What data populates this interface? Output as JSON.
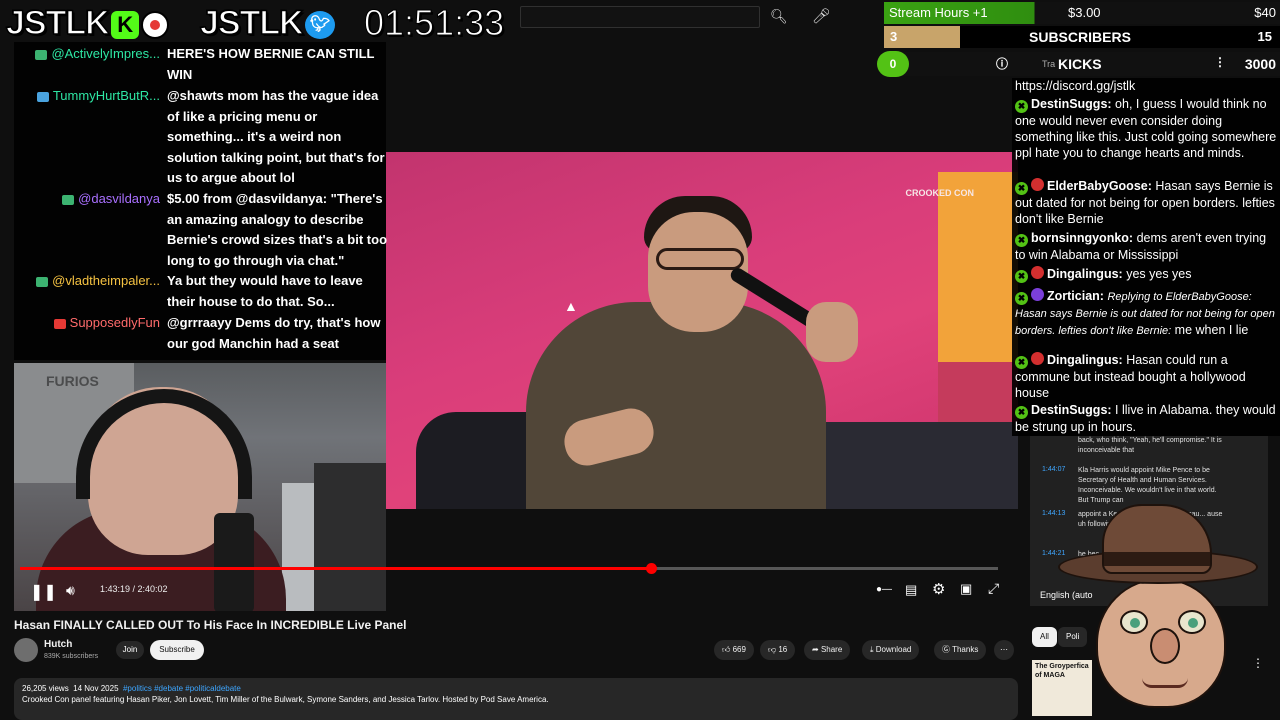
{
  "overlay": {
    "logo_kick": "JSTLK",
    "logo_kick_badge": "K",
    "logo_twitter": "JSTLK",
    "clock": "01:51:33"
  },
  "goals": {
    "stream_hours": {
      "label": "Stream Hours +1",
      "current": "$3.00",
      "target": "$40"
    },
    "subscribers": {
      "label": "SUBSCRIBERS",
      "current": "3",
      "target": "15"
    },
    "kicks": {
      "label": "KICKS",
      "current": "0",
      "target": "3000",
      "prefix": "Tra"
    }
  },
  "left_chat": [
    {
      "name": "@ActivelyImpres...",
      "message": "HERE'S HOW BERNIE CAN STILL WIN",
      "name_color": "#2ee6a4",
      "icon_color": "#3cb371"
    },
    {
      "name": "TummyHurtButR...",
      "message": "@shawts mom has the vague idea of like a pricing menu or something... it's a weird non solution talking point, but that's for us to argue about lol",
      "name_color": "#2ee6a4",
      "icon_color": "#4aa3df"
    },
    {
      "name": "@dasvildanya",
      "message": "$5.00 from @dasvildanya: \"There's an amazing analogy to describe Bernie's crowd sizes that's a bit too long to go through via chat.\"",
      "name_color": "#a970ff",
      "icon_color": "#3cb371"
    },
    {
      "name": "@vladtheimpaler...",
      "message": "Ya but they would have to leave their house to do that. So...",
      "name_color": "#f5c242",
      "icon_color": "#3cb371"
    },
    {
      "name": "SupposedlyFun",
      "message": "@grrraayy Dems do try, that's how our god Manchin had a seat",
      "name_color": "#ff6b6b",
      "icon_color": "#e53935"
    }
  ],
  "video": {
    "sign_text": "CROOKED CON",
    "webcam_sign": "FURIOS",
    "current_time": "1:43:19",
    "duration": "2:40:02",
    "time_display": "1:43:19 / 2:40:02",
    "progress": 0.645
  },
  "meta": {
    "title": "Hasan FINALLY CALLED OUT To His Face In INCREDIBLE Live Panel",
    "channel": "Hutch",
    "subscribers": "839K subscribers",
    "join_label": "Join",
    "subscribe_label": "Subscribe",
    "likes": "669",
    "dislikes": "16",
    "share_label": "Share",
    "download_label": "Download",
    "thanks_label": "Thanks",
    "views": "26,205 views",
    "date": "14 Nov 2025",
    "tags": "#politics #debate #politicaldebate",
    "description": "Crooked Con panel featuring Hasan Piker, Jon Lovett, Tim Miller of the Bulwark, Symone Sanders, and Jessica Tarlov. Hosted by Pod Save America."
  },
  "right_chat": [
    {
      "name": "",
      "message": "https://discord.gg/jstlk",
      "badges": []
    },
    {
      "name": "DestinSuggs:",
      "message": "oh, I guess I would think no one would never even consider doing something like this. Just cold going somewhere ppl hate you to change hearts and minds.",
      "badges": [
        "kick"
      ]
    },
    {
      "name": "ElderBabyGoose:",
      "message": "Hasan says Bernie is out dated for not being for open borders. lefties don't like Bernie",
      "badges": [
        "kick",
        "red"
      ]
    },
    {
      "name": "bornsinngyonko:",
      "message": "dems aren't even trying to win Alabama or Mississippi",
      "badges": [
        "kick"
      ]
    },
    {
      "name": "Dingalingus:",
      "message": "yes yes yes",
      "badges": [
        "kick",
        "red"
      ]
    },
    {
      "name": "Zortician:",
      "quote": "Replying to ElderBabyGoose: Hasan says Bernie is out dated for not being for open borders. lefties don't like Bernie:",
      "message": "me when I lie",
      "badges": [
        "kick",
        "purple"
      ]
    },
    {
      "name": "Dingalingus:",
      "message": "Hasan could run a commune but instead bought a hollywood house",
      "badges": [
        "kick",
        "red"
      ]
    },
    {
      "name": "DestinSuggs:",
      "message": "I llive in Alabama. they would be strung up in hours.",
      "badges": [
        "kick"
      ]
    }
  ],
  "transcript": {
    "top_text": "back, who think, \"Yeah, he'll compromise.\" It is inconceivable that",
    "rows": [
      {
        "ts": "1:44:07",
        "text": "Kla Harris would appoint Mike Pence to be Secretary of Health and Human Services. Inconceivable. We wouldn't live in that world. But Trump can"
      },
      {
        "ts": "1:44:13",
        "text": "appoint a Ke... epartment. Why? becau... ause uh following"
      },
      {
        "ts": "1:44:21",
        "text": "he bec"
      }
    ],
    "language": "English (auto",
    "chip_all": "All",
    "chip_poli": "Poli",
    "thumb_text": "The Groyperfica of MAGA"
  },
  "colors": {
    "accent_red": "#ff0000",
    "kick_green": "#53c215",
    "link_blue": "#3ea6ff"
  }
}
